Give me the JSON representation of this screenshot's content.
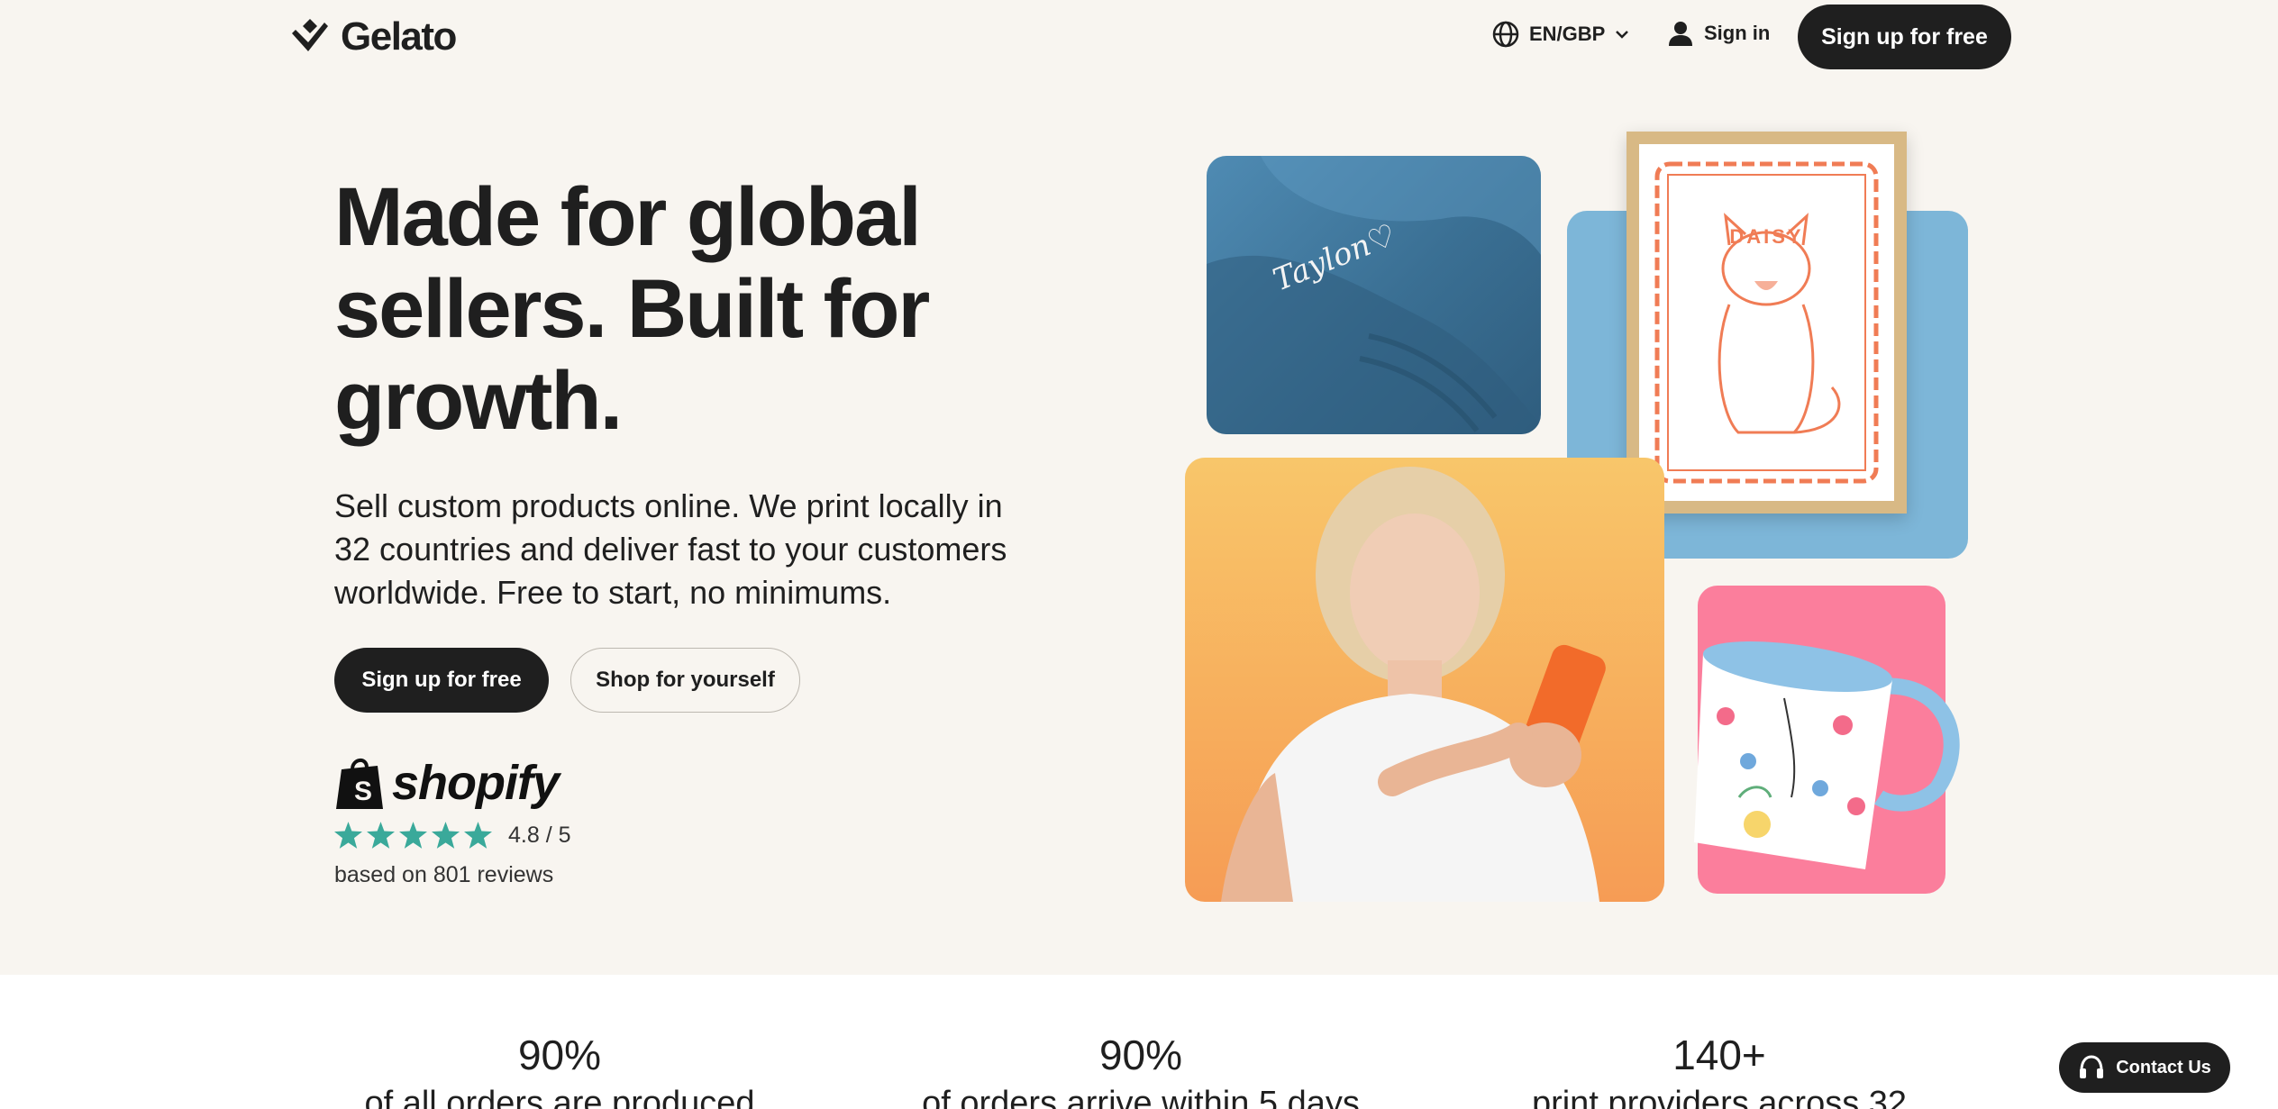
{
  "header": {
    "logo_text": "Gelato",
    "language": "EN/GBP",
    "signin_label": "Sign in",
    "signup_label": "Sign up for free"
  },
  "hero": {
    "title_lines": [
      "Made for global",
      "sellers. Built for",
      "growth."
    ],
    "subtitle_lines": [
      "Sell custom products online. We print locally in",
      "32 countries and deliver fast to your customers",
      "worldwide. Free to start, no minimums."
    ],
    "primary_button": "Sign up for free",
    "secondary_button": "Shop for yourself",
    "shopify_word": "shopify",
    "stars": 5,
    "rating_value": "4.8 / 5",
    "reviews_text": "based on 801 reviews"
  },
  "collage": {
    "hoodie_text": "Taylon♡",
    "frame_text": "DAISY"
  },
  "stats": [
    {
      "value": "90%",
      "text": "of all orders are produced"
    },
    {
      "value": "90%",
      "text": "of orders arrive within 5 days"
    },
    {
      "value": "140+",
      "text": "print providers across 32"
    }
  ],
  "contact_label": "Contact Us",
  "colors": {
    "background": "#f8f5f0",
    "dark": "#1f1f1f",
    "star_green": "#3aa99a",
    "hoodie_blue": "#3a6f93",
    "tile_blue": "#7db6d8",
    "tile_orange": "#f7ad5c",
    "tile_pink": "#fb7e9c",
    "frame_wood": "#d8b985",
    "accent_orange": "#f07c55"
  }
}
